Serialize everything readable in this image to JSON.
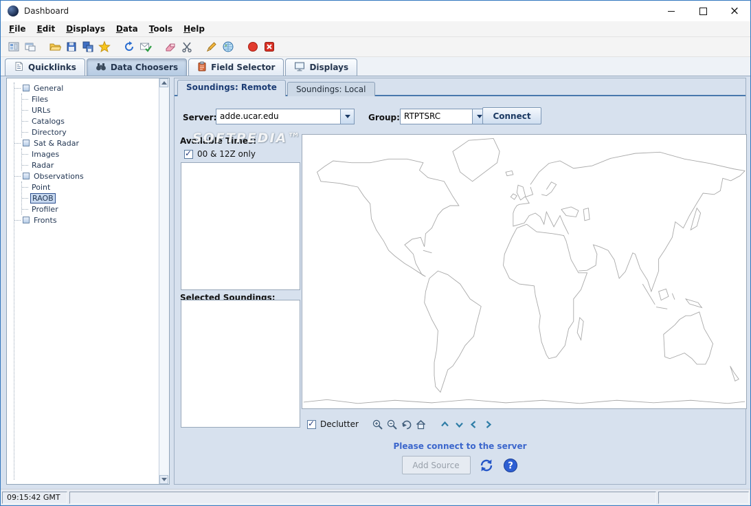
{
  "window": {
    "title": "Dashboard",
    "statusbar_time": "09:15:42 GMT",
    "watermark": "SOFTPEDIA™"
  },
  "colors": {
    "accent_blue": "#4878ad",
    "status_message_text": "#3b66cc",
    "selection_highlight": "#c8d9f0",
    "record_red": "#e23b2e"
  },
  "menu": {
    "items": [
      {
        "label": "File"
      },
      {
        "label": "Edit"
      },
      {
        "label": "Displays"
      },
      {
        "label": "Data"
      },
      {
        "label": "Tools"
      },
      {
        "label": "Help"
      }
    ]
  },
  "toolbar": {
    "icons": [
      "show-dashboard",
      "new-display-window",
      "open-bundle",
      "save-bundle",
      "save-bundle-as",
      "toggle-favorites",
      "refresh",
      "capture-image",
      "erase-display",
      "cut",
      "draw",
      "globe-display",
      "record-movie",
      "remove-all-displays"
    ]
  },
  "main_tabs": {
    "tabs": [
      {
        "label": "Quicklinks",
        "icon": "quicklinks-icon",
        "selected": false
      },
      {
        "label": "Data Choosers",
        "icon": "binoculars-icon",
        "selected": true
      },
      {
        "label": "Field Selector",
        "icon": "clipboard-icon",
        "selected": false
      },
      {
        "label": "Displays",
        "icon": "monitor-icon",
        "selected": false
      }
    ]
  },
  "tree": {
    "groups": [
      {
        "label": "General",
        "children": [
          {
            "label": "Files"
          },
          {
            "label": "URLs"
          },
          {
            "label": "Catalogs"
          },
          {
            "label": "Directory"
          }
        ]
      },
      {
        "label": "Sat & Radar",
        "children": [
          {
            "label": "Images"
          },
          {
            "label": "Radar"
          }
        ]
      },
      {
        "label": "Observations",
        "children": [
          {
            "label": "Point"
          },
          {
            "label": "RAOB",
            "selected": true
          },
          {
            "label": "Profiler"
          }
        ]
      },
      {
        "label": "Fronts",
        "children": []
      }
    ]
  },
  "chooser": {
    "tabs": [
      {
        "label": "Soundings: Remote",
        "selected": true
      },
      {
        "label": "Soundings: Local",
        "selected": false
      }
    ],
    "server_label": "Server:",
    "server_value": "adde.ucar.edu",
    "group_label": "Group:",
    "group_value": "RTPTSRC",
    "connect_label": "Connect",
    "available_times_label": "Available Times:",
    "times_filter_label": "00 & 12Z only",
    "times_filter_checked": true,
    "selected_soundings_label": "Selected Soundings:",
    "declutter_label": "Declutter",
    "declutter_checked": true,
    "status_message": "Please connect to the server",
    "add_source_label": "Add Source",
    "map_tools": [
      "zoom-in",
      "zoom-out",
      "undo-view",
      "reset-projection"
    ],
    "nav_arrows": [
      "pan-up",
      "pan-down",
      "pan-left",
      "pan-right"
    ]
  }
}
